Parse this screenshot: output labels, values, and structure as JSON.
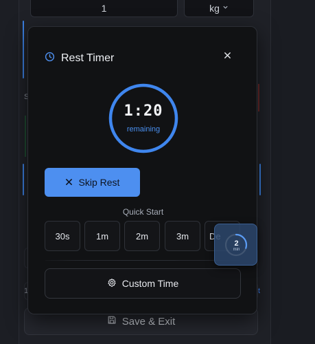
{
  "background": {
    "quantity_value": "1",
    "unit_value": "kg",
    "save_exit_label": "Save & Exit",
    "side_char_left": "S",
    "side_char_left_2": "1",
    "side_link_right": "t"
  },
  "modal": {
    "title": "Rest Timer",
    "timer": {
      "display": "1:20",
      "sub_label": "remaining",
      "remaining_fraction": 1.0
    },
    "skip_label": "Skip Rest",
    "quick_start_label": "Quick Start",
    "quick_options": [
      "30s",
      "1m",
      "2m",
      "3m",
      "De"
    ],
    "custom_label": "Custom Time"
  },
  "mini_timer": {
    "value": "2",
    "unit": "min",
    "progress_fraction": 0.3
  },
  "colors": {
    "accent": "#4d8ff0",
    "ring": "#3f86ee",
    "surface": "#111214",
    "border": "#2f3239"
  },
  "icons": {
    "header": "clock-icon",
    "close": "close-icon",
    "skip": "x-icon",
    "custom": "gear-icon",
    "save": "floppy-disk-icon",
    "unit_dropdown": "chevron-down-icon"
  }
}
